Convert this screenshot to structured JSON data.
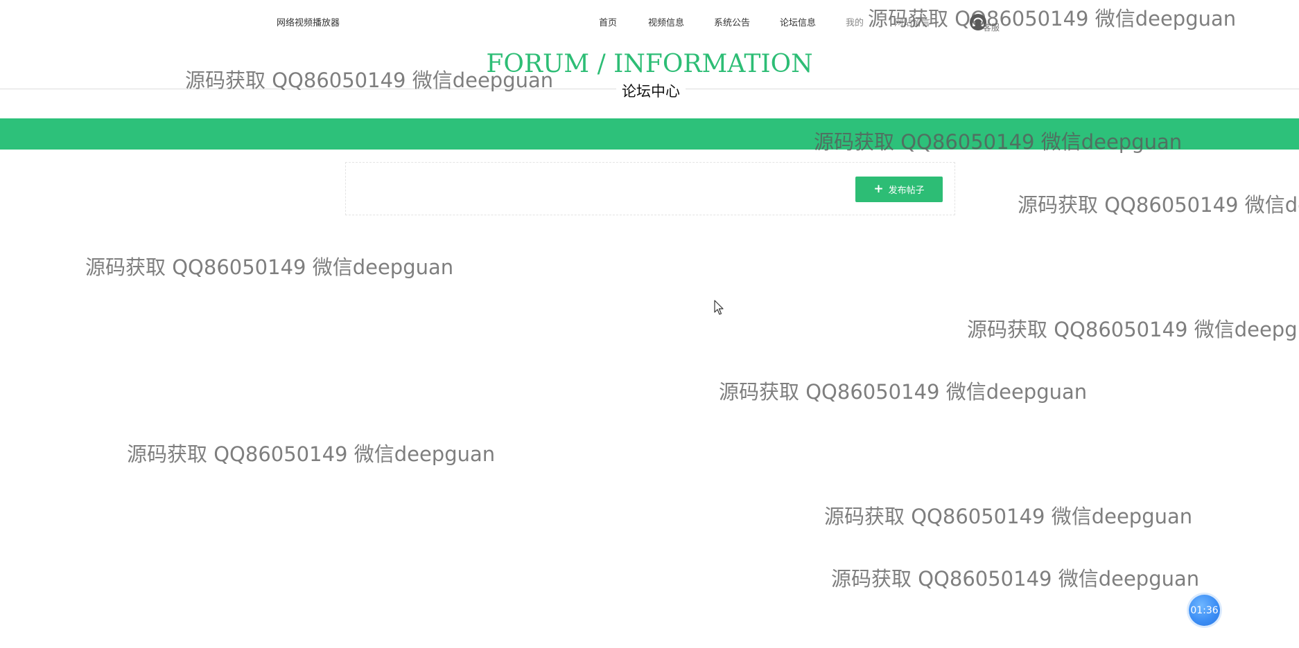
{
  "header": {
    "site_name": "网络视频播放器",
    "nav": [
      {
        "label": "首页"
      },
      {
        "label": "视频信息"
      },
      {
        "label": "系统公告"
      },
      {
        "label": "论坛信息"
      },
      {
        "label": "我的"
      },
      {
        "label": "网站留言"
      }
    ],
    "service_label": "客服",
    "service_icon": "headset-icon"
  },
  "hero": {
    "title_en": "FORUM / INFORMATION",
    "title_cn": "论坛中心"
  },
  "toolbar": {
    "post_button_label": "发布帖子",
    "post_button_icon": "plus-icon"
  },
  "watermark_text": "源码获取 QQ86050149 微信deepguan",
  "timer": {
    "label": "01:36"
  },
  "colors": {
    "brand_green": "#2dbd75",
    "band_green": "#2dc17a",
    "timer_blue": "#3d8ff5"
  }
}
